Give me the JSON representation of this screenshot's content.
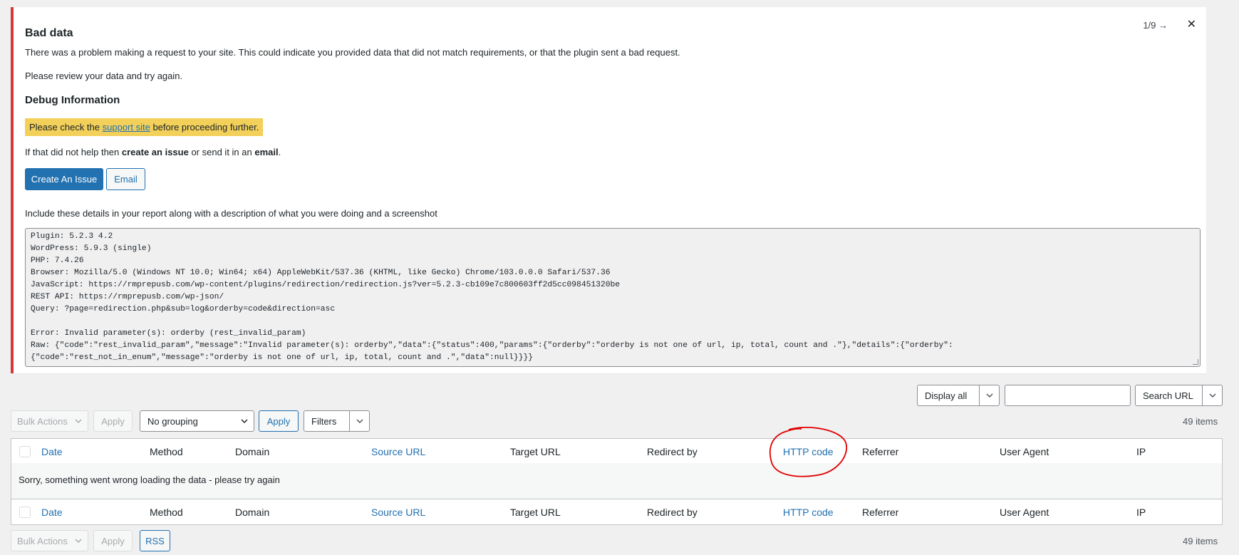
{
  "notice": {
    "title": "Bad data",
    "pager": "1/9 →",
    "close": "✕",
    "paragraph1": "There was a problem making a request to your site. This could indicate you provided data that did not match requirements, or that the plugin sent a bad request.",
    "paragraph2": "Please review your data and try again.",
    "debug_heading": "Debug Information",
    "support_prefix": "Please check the ",
    "support_link": "support site",
    "support_suffix": " before proceeding further.",
    "help_prefix": "If that did not help then ",
    "help_bold1": "create an issue",
    "help_middle": " or send it in an ",
    "help_bold2": "email",
    "help_suffix": ".",
    "create_issue_button": "Create An Issue",
    "email_button": "Email",
    "include_line": "Include these details in your report along with a description of what you were doing and a screenshot",
    "debug_text": "Plugin: 5.2.3 4.2\nWordPress: 5.9.3 (single)\nPHP: 7.4.26\nBrowser: Mozilla/5.0 (Windows NT 10.0; Win64; x64) AppleWebKit/537.36 (KHTML, like Gecko) Chrome/103.0.0.0 Safari/537.36\nJavaScript: https://rmprepusb.com/wp-content/plugins/redirection/redirection.js?ver=5.2.3-cb109e7c800603ff2d5cc098451320be\nREST API: https://rmprepusb.com/wp-json/\nQuery: ?page=redirection.php&sub=log&orderby=code&direction=asc\n\nError: Invalid parameter(s): orderby (rest_invalid_param)\nRaw: {\"code\":\"rest_invalid_param\",\"message\":\"Invalid parameter(s): orderby\",\"data\":{\"status\":400,\"params\":{\"orderby\":\"orderby is not one of url, ip, total, count and .\"},\"details\":{\"orderby\":\n{\"code\":\"rest_not_in_enum\",\"message\":\"orderby is not one of url, ip, total, count and .\",\"data\":null}}}}"
  },
  "search": {
    "display_select": "Display all",
    "input_value": "",
    "search_button": "Search URL"
  },
  "top_nav": {
    "bulk_actions": "Bulk Actions",
    "apply_disabled": "Apply",
    "grouping": "No grouping",
    "apply": "Apply",
    "filters": "Filters",
    "count": "49 items"
  },
  "table": {
    "columns": [
      "Date",
      "Method",
      "Domain",
      "Source URL",
      "Target URL",
      "Redirect by",
      "HTTP code",
      "Referrer",
      "User Agent",
      "IP"
    ],
    "message": "Sorry, something went wrong loading the data - please try again"
  },
  "bottom_nav": {
    "bulk_actions": "Bulk Actions",
    "apply_disabled": "Apply",
    "rss": "RSS",
    "count": "49 items"
  },
  "colors": {
    "accent": "#2271b1",
    "error": "#d63638",
    "highlight": "#f2d05a",
    "annotation": "#e00000"
  }
}
